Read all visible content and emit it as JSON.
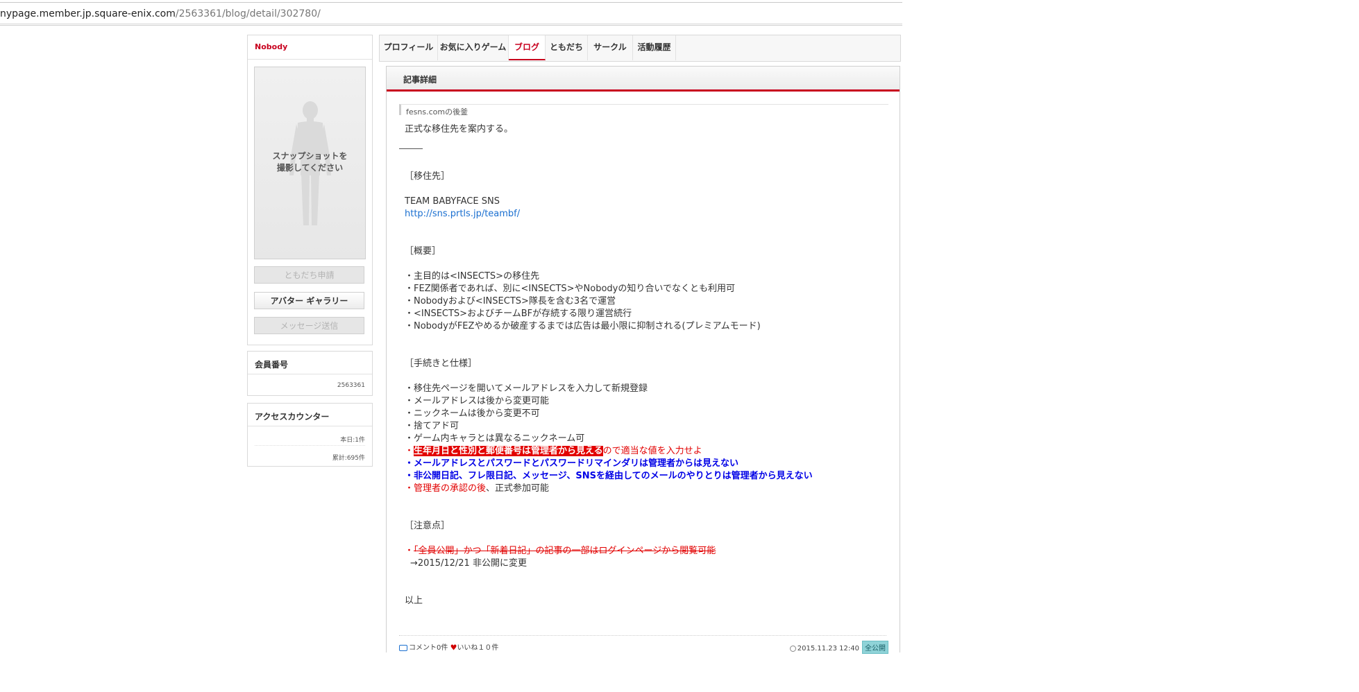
{
  "url": {
    "host": "nypage.member.jp.square-enix.com",
    "path": "/2563361/blog/detail/302780/"
  },
  "profile": {
    "name": "Nobody",
    "avatar_message_line1": "スナップショットを",
    "avatar_message_line2": "撮影してください",
    "buttons": {
      "friend_request": "ともだち申請",
      "avatar_gallery": "アバター ギャラリー",
      "send_message": "メッセージ送信"
    }
  },
  "member": {
    "title": "会員番号",
    "number": "2563361"
  },
  "access": {
    "title": "アクセスカウンター",
    "today": "本日:1件",
    "total": "累計:695件"
  },
  "tabs": [
    {
      "label": "プロフィール"
    },
    {
      "label": "お気に入りゲーム"
    },
    {
      "label": "ブログ"
    },
    {
      "label": "ともだち"
    },
    {
      "label": "サークル"
    },
    {
      "label": "活動履歴"
    }
  ],
  "article": {
    "header": "記事詳細",
    "post_title": "fesns.comの後釜",
    "intro": "正式な移住先を案内する。",
    "sec1": "［移住先］",
    "site_name": "TEAM BABYFACE SNS",
    "site_url": "http://sns.prtls.jp/teambf/",
    "sec2": "［概要］",
    "overview": [
      "・主目的は<INSECTS>の移住先",
      "・FEZ関係者であれば、別に<INSECTS>やNobodyの知り合いでなくとも利用可",
      "・Nobodyおよび<INSECTS>隊長を含む3名で運営",
      "・<INSECTS>およびチームBFが存続する限り運営続行",
      "・NobodyがFEZやめるか破産するまでは広告は最小限に抑制される(プレミアムモード)"
    ],
    "sec3": "［手続きと仕様］",
    "procedures": [
      "・移住先ページを開いてメールアドレスを入力して新規登録",
      "・メールアドレスは後から変更可能",
      "・ニックネームは後から変更不可",
      "・捨てアド可",
      "・ゲーム内キャラとは異なるニックネーム可"
    ],
    "warn_bullet": "・",
    "warn_highlight": "生年月日と性別と郵便番号は管理者から見える",
    "warn_rest": "ので適当な値を入力せよ",
    "blue1": "・メールアドレスとパスワードとパスワードリマインダリは管理者からは見えない",
    "blue2": "・非公開日記、フレ限日記、メッセージ、SNSを経由してのメールのやりとりは管理者から見えない",
    "approval_bullet": "・",
    "approval_red": "管理者の承認の後",
    "approval_rest": "、正式参加可能",
    "sec4": "［注意点］",
    "notice_bullet": "・",
    "notice_struck": "「全員公開」かつ「新着日記」の記事の一部はログインページから閲覧可能",
    "notice_change": "→2015/12/21 非公開に変更",
    "closing": "以上",
    "footer": {
      "comments": "コメント0件",
      "likes": "いいね１０件",
      "datetime": "2015.11.23 12:40",
      "visibility": "全公開"
    }
  },
  "colors": {
    "accent": "#c8001e",
    "link": "#1a6fd0",
    "warn": "#e20000",
    "info": "#0000e6"
  }
}
